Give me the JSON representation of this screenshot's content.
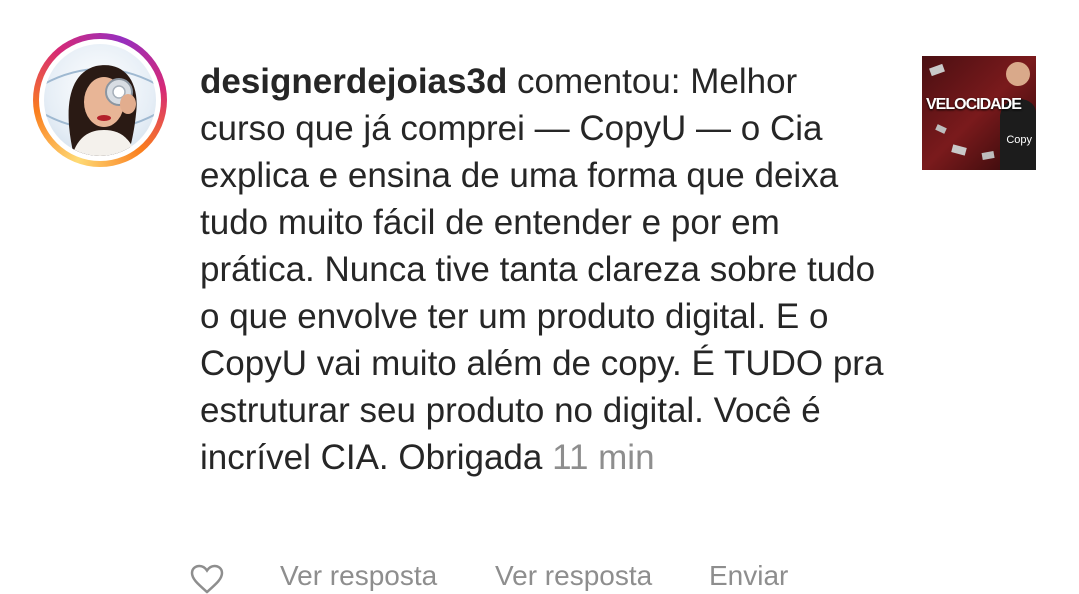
{
  "comment": {
    "username": "designerdejoias3d",
    "text": " comentou: Melhor curso que já comprei — CopyU — o Cia explica e ensina de uma forma que deixa tudo muito fácil de entender e por em prática. Nunca tive tanta clareza sobre tudo o que envolve ter um produto digital. E o CopyU vai muito além de copy. É TUDO pra estruturar seu produto no digital. Você é incrível CIA. Obrigada ",
    "timestamp": "11 min"
  },
  "thumbnail": {
    "title": "VELOCIDADE",
    "subtitle": "Copy"
  },
  "actions": {
    "reply_1": "Ver resposta",
    "reply_2": "Ver resposta",
    "send": "Enviar"
  },
  "colors": {
    "text": "#262626",
    "muted": "#8e8e8e",
    "story_ring": [
      "#feda75",
      "#fa7e1e",
      "#d62976",
      "#962fbf"
    ]
  }
}
